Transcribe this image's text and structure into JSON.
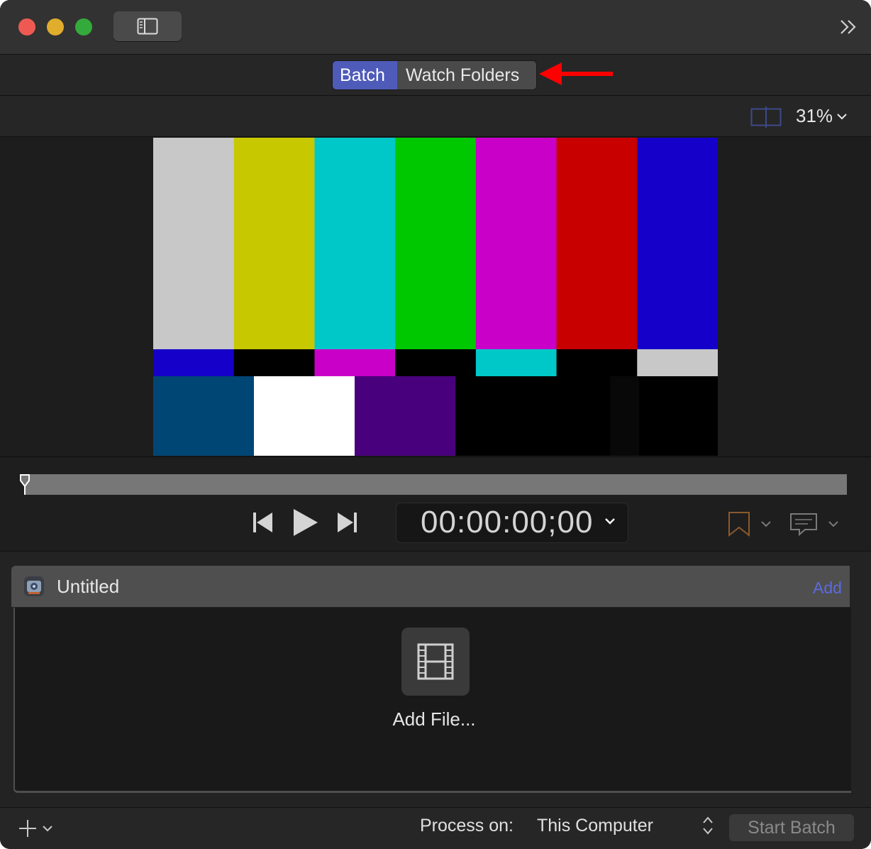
{
  "toolbar": {
    "sidebar_toggle_icon": "sidebar-icon",
    "overflow_icon": "double-chevron-right-icon"
  },
  "mode_switch": {
    "options": [
      "Batch",
      "Watch Folders"
    ],
    "selected": "Batch",
    "accent_color": "#4e5bb9"
  },
  "annotation": {
    "arrow_color": "#ff0000"
  },
  "viewer": {
    "zoom": "31%",
    "compare_icon": "split-view-icon",
    "test_pattern": {
      "top_colors": [
        "#c8c8c8",
        "#c8c800",
        "#00c8c8",
        "#00c800",
        "#c800c8",
        "#c80000",
        "#1400c8"
      ],
      "middle_colors": [
        "#1400c8",
        "#000000",
        "#c800c8",
        "#000000",
        "#00c8c8",
        "#000000",
        "#c8c8c8"
      ],
      "bottom_colors": [
        "#004675",
        "#ffffff",
        "#48007c",
        "#000000",
        "#000000",
        "#080808",
        "#000000"
      ]
    }
  },
  "transport": {
    "timecode": "00:00:00;00",
    "playhead_progress": 0,
    "prev_icon": "skip-back-icon",
    "play_icon": "play-icon",
    "next_icon": "skip-forward-icon",
    "marker_icon": "bookmark-icon",
    "caption_icon": "caption-icon"
  },
  "batch": {
    "title": "Untitled",
    "add_label": "Add",
    "add_file_label": "Add File..."
  },
  "footer": {
    "process_label": "Process on:",
    "process_value": "This Computer",
    "start_button": "Start Batch"
  }
}
